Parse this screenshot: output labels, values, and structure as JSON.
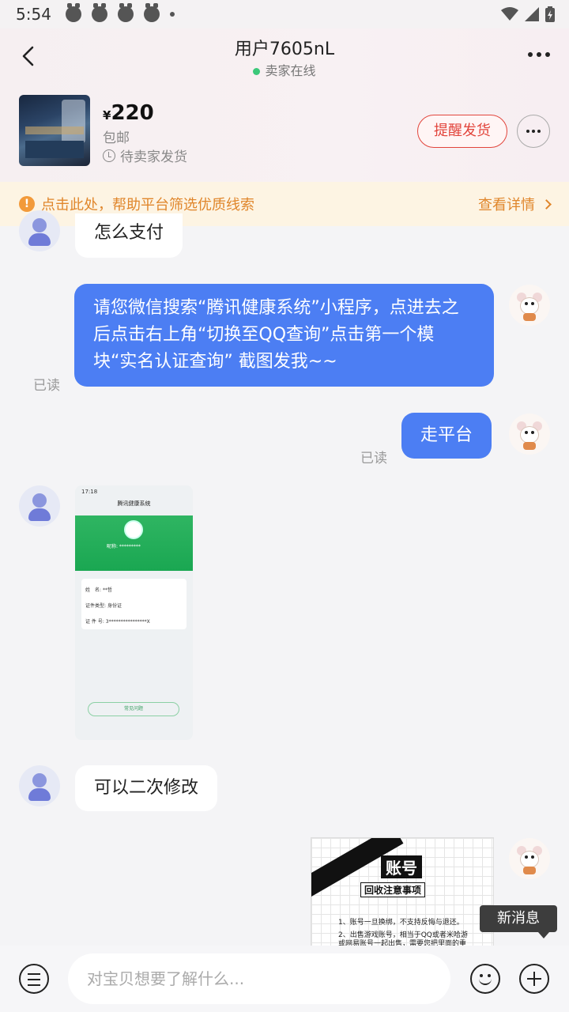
{
  "status_bar": {
    "time": "5:54"
  },
  "header": {
    "title": "用户7605nL",
    "online_status": "卖家在线"
  },
  "product": {
    "currency": "¥",
    "price": "220",
    "shipping": "包邮",
    "order_status": "待卖家发货",
    "remind_button": "提醒发货"
  },
  "notice": {
    "text": "点击此处，帮助平台筛选优质线索",
    "detail_link": "查看详情"
  },
  "messages": [
    {
      "from": "seller",
      "text": "怎么支付"
    },
    {
      "from": "me",
      "text": "请您微信搜索“腾讯健康系统”小程序，点进去之后点击右上角“切换至QQ查询”点击第一个模块“实名认证查询” 截图发我~~",
      "read": "已读"
    },
    {
      "from": "me",
      "text": "走平台",
      "read": "已读"
    },
    {
      "from": "seller",
      "type": "image"
    },
    {
      "from": "seller",
      "text": "可以二次修改"
    },
    {
      "from": "me",
      "type": "image"
    }
  ],
  "image1": {
    "time": "17:18",
    "title": "腾讯健康系统",
    "nickname": "昵称: *********",
    "field1_label": "姓　名:",
    "field1_value": "**哲",
    "field2_label": "证件类型:",
    "field2_value": "身份证",
    "field3_label": "证 件 号:",
    "field3_value": "3****************X",
    "button": "常见问题"
  },
  "image2": {
    "heading": "账号",
    "subheading": "回收注意事项",
    "line1": "1、账号一旦换绑，不支持反悔与退还。",
    "line2": "2、出售游戏账号，相当于QQ或者米哈游或网易账号一起出售，需要您把里面的重"
  },
  "tooltip": "新消息",
  "input_placeholder": "对宝贝想要了解什么..."
}
